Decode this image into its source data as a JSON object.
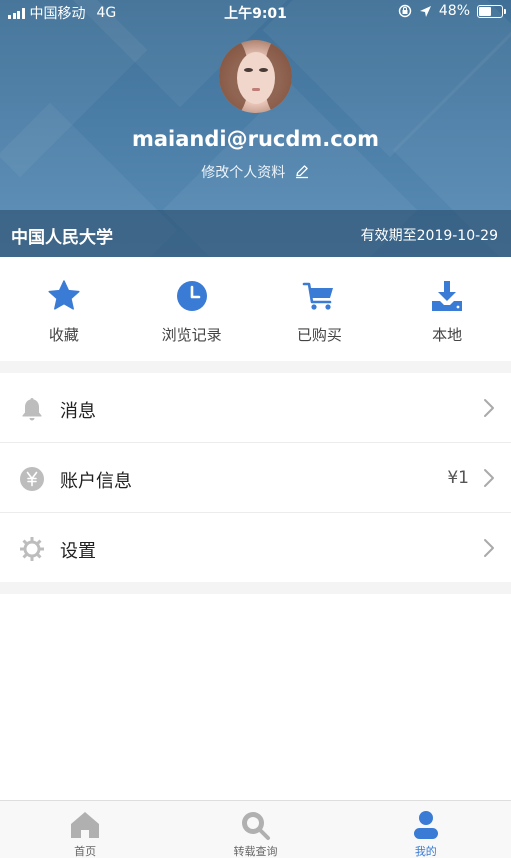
{
  "status_bar": {
    "carrier": "中国移动",
    "network": "4G",
    "time": "上午9:01",
    "battery_percent": "48%",
    "battery_level": 0.48
  },
  "profile": {
    "email": "maiandi@rucdm.com",
    "edit_label": "修改个人资料"
  },
  "organization": {
    "name": "中国人民大学",
    "expiry": "有效期至2019-10-29"
  },
  "quick_actions": [
    {
      "label": "收藏",
      "icon": "star-icon"
    },
    {
      "label": "浏览记录",
      "icon": "clock-icon"
    },
    {
      "label": "已购买",
      "icon": "cart-icon"
    },
    {
      "label": "本地",
      "icon": "download-icon"
    }
  ],
  "menu": [
    {
      "label": "消息",
      "icon": "bell-icon",
      "value": ""
    },
    {
      "label": "账户信息",
      "icon": "yen-icon",
      "value": "¥1"
    },
    {
      "label": "设置",
      "icon": "gear-icon",
      "value": ""
    }
  ],
  "tabs": [
    {
      "label": "首页",
      "icon": "home-icon",
      "active": false
    },
    {
      "label": "转载查询",
      "icon": "search-icon",
      "active": false
    },
    {
      "label": "我的",
      "icon": "user-icon",
      "active": true
    }
  ],
  "colors": {
    "accent": "#3a7bd5",
    "header": "#4a7da6",
    "icon_gray": "#b8b8b8"
  }
}
